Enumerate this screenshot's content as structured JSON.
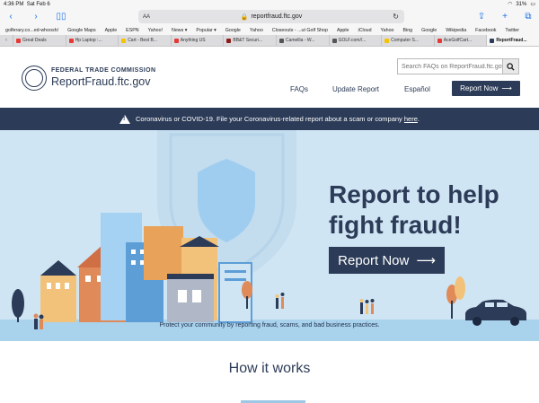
{
  "status": {
    "time": "4:36 PM",
    "date": "Sat Feb 6",
    "battery": "31%"
  },
  "browser": {
    "address_prefix": "AA",
    "url": "reportfraud.ftc.gov",
    "favorites": [
      "golferary.co...ed-whoosh/",
      "Google Maps",
      "Apple",
      "ESPN",
      "Yahoo!",
      "News ▾",
      "Popular ▾",
      "Google",
      "Yahoo",
      "Closeouts - ...ut Golf Shop",
      "Apple",
      "iCloud",
      "Yahoo",
      "Bing",
      "Google",
      "Wikipedia",
      "Facebook",
      "Twitter"
    ],
    "tabs": [
      {
        "label": "Great Deals",
        "color": "#e53935"
      },
      {
        "label": "Hp Laptop :...",
        "color": "#e53935"
      },
      {
        "label": "Cart - Best B...",
        "color": "#f5c400"
      },
      {
        "label": "Anything US",
        "color": "#e53935"
      },
      {
        "label": "BB&T Securi...",
        "color": "#8e1b1b"
      },
      {
        "label": "Camellia - W...",
        "color": "#555555"
      },
      {
        "label": "GOLF.com//...",
        "color": "#555555"
      },
      {
        "label": "Computer S...",
        "color": "#f5c400"
      },
      {
        "label": "AceGolfCart...",
        "color": "#e53935"
      },
      {
        "label": "ReportFraud...",
        "color": "#2c3b57"
      }
    ]
  },
  "header": {
    "agency": "FEDERAL TRADE COMMISSION",
    "site_name": "ReportFraud.ftc.gov",
    "search_placeholder": "Search FAQs on ReportFraud.ftc.gov",
    "nav": {
      "faqs": "FAQs",
      "update": "Update Report",
      "espanol": "Español"
    },
    "report_button": "Report Now"
  },
  "alert": {
    "text": "Coronavirus or COVID-19. File your Coronavirus-related report about a scam or company",
    "link": "here",
    "end": "."
  },
  "hero": {
    "title_line1": "Report to help",
    "title_line2": "fight fraud!",
    "button": "Report Now",
    "caption": "Protect your community by reporting fraud, scams, and bad business practices."
  },
  "how": {
    "title": "How it works"
  },
  "colors": {
    "navy": "#2c3b57",
    "hero_bg": "#cfe5f3",
    "accent": "#9cc7e6"
  }
}
